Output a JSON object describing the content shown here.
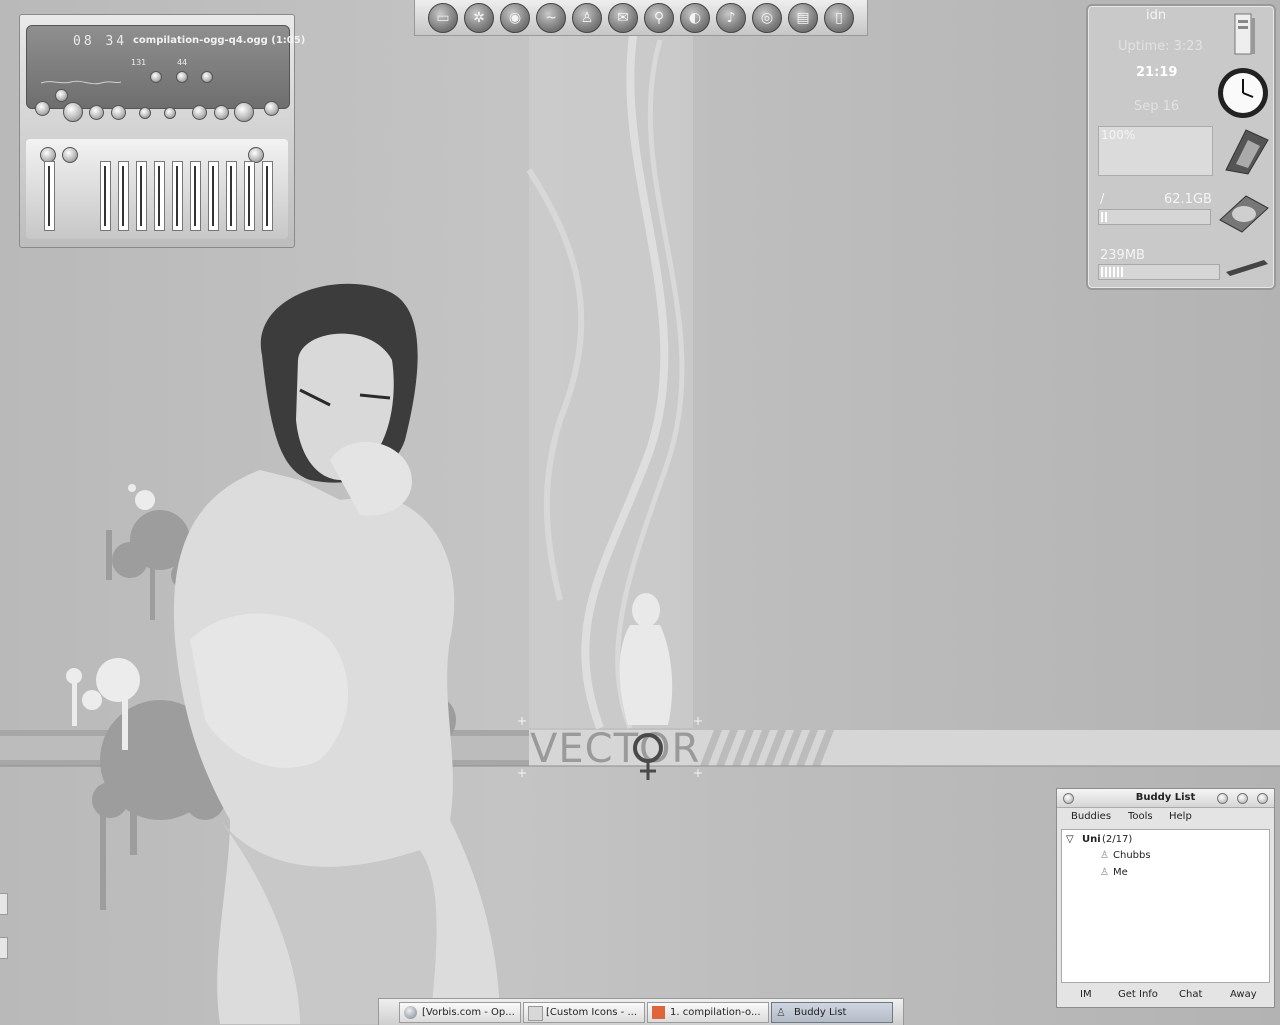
{
  "wallpaper": {
    "logo_text": "VECTOR"
  },
  "player": {
    "time": "08 34",
    "track_title": "compilation-ogg-q4.ogg (1:05)",
    "bitrate": "131",
    "samplerate": "44"
  },
  "launcher": {
    "icons": [
      "home-icon",
      "settings-icon",
      "nvidia-icon",
      "terminal-icon",
      "person-icon",
      "mail-icon",
      "network-icon",
      "browser-icon",
      "music-icon",
      "cd-icon",
      "video-icon",
      "notes-icon"
    ]
  },
  "sysmon": {
    "hostname": "idn",
    "uptime": "Uptime: 3:23",
    "time": "21:19",
    "date": "Sep 16",
    "cpu_label": "100%",
    "cpu_percent": 100,
    "disk_mount": "/",
    "disk_size": "62.1GB",
    "disk_fraction": 0.04,
    "memory_label": "239MB",
    "memory_fraction": 0.2
  },
  "buddy_list": {
    "title": "Buddy List",
    "menus": [
      "Buddies",
      "Tools",
      "Help"
    ],
    "group_name": "Uni",
    "group_count": "(2/17)",
    "buddies": [
      "Chubbs",
      "Me"
    ],
    "buttons": [
      "IM",
      "Get Info",
      "Chat",
      "Away"
    ]
  },
  "taskbar": {
    "tasks": [
      {
        "label": "[Vorbis.com - Op...",
        "icon": "browser-icon"
      },
      {
        "label": "[Custom Icons - ...",
        "icon": "folder-icon"
      },
      {
        "label": "1. compilation-o...",
        "icon": "player-icon"
      },
      {
        "label": "Buddy List",
        "icon": "buddy-icon",
        "active": true
      }
    ]
  },
  "colors": {
    "accent_dark": "#3a3a3a",
    "panel": "#c9c9c9",
    "active_task": "#b4bcc8"
  }
}
